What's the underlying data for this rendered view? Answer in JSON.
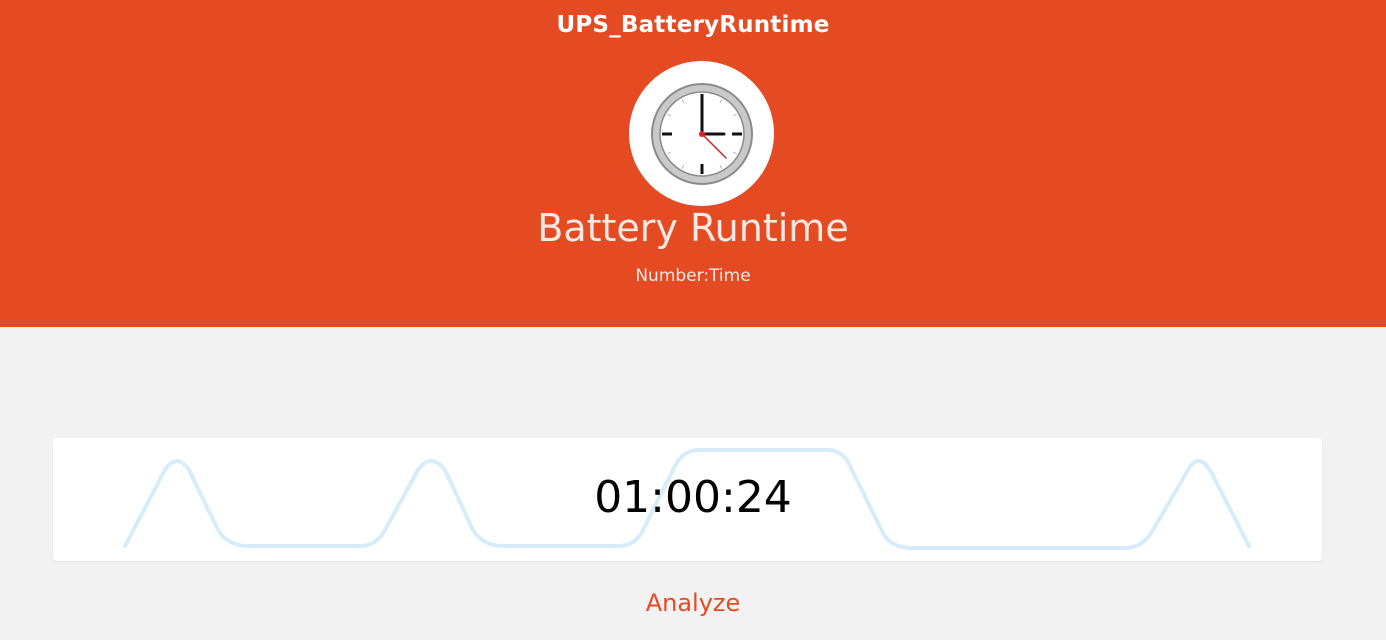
{
  "header": {
    "item_name": "UPS_BatteryRuntime",
    "label": "Battery Runtime",
    "type": "Number:Time",
    "icon": "clock-icon",
    "background_color": "#e44b23"
  },
  "state": {
    "value": "01:00:24",
    "sparkline_color": "#d6ecfb"
  },
  "actions": {
    "analyze_label": "Analyze"
  }
}
